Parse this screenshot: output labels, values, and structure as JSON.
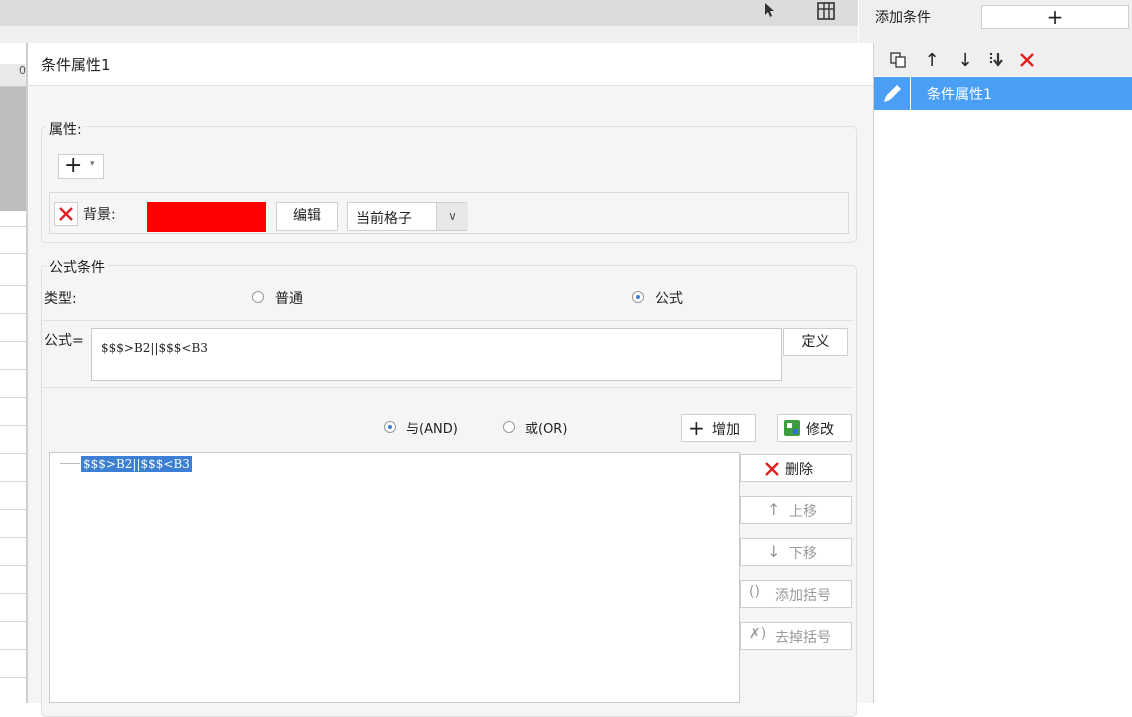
{
  "top": {
    "add_condition_label": "添加条件",
    "add_symbol": "+"
  },
  "sheet": {
    "header_text": "0"
  },
  "dialog": {
    "title": "条件属性1",
    "attributes": {
      "legend": "属性:",
      "add_button": "+",
      "background_label": "背景:",
      "background_color": "#ff0000",
      "edit_button": "编辑",
      "scope_value": "当前格子"
    },
    "formula_condition": {
      "legend": "公式条件",
      "type_label": "类型:",
      "type_options": [
        {
          "label": "普通",
          "selected": false
        },
        {
          "label": "公式",
          "selected": true
        }
      ],
      "formula_label": "公式=",
      "formula_value": "$$$>B2||$$$<B3",
      "define_button": "定义",
      "logic_options": [
        {
          "label": "与(AND)",
          "selected": true
        },
        {
          "label": "或(OR)",
          "selected": false
        }
      ],
      "add_button": "增加",
      "modify_button": "修改",
      "tree_item": "$$$>B2||$$$<B3",
      "side_buttons": {
        "delete": "删除",
        "move_up": "上移",
        "move_down": "下移",
        "add_bracket": "添加括号",
        "remove_bracket": "去掉括号"
      }
    }
  },
  "right_panel": {
    "items": [
      {
        "label": "条件属性1",
        "selected": true
      }
    ],
    "accent_color": "#4a9ff5"
  }
}
